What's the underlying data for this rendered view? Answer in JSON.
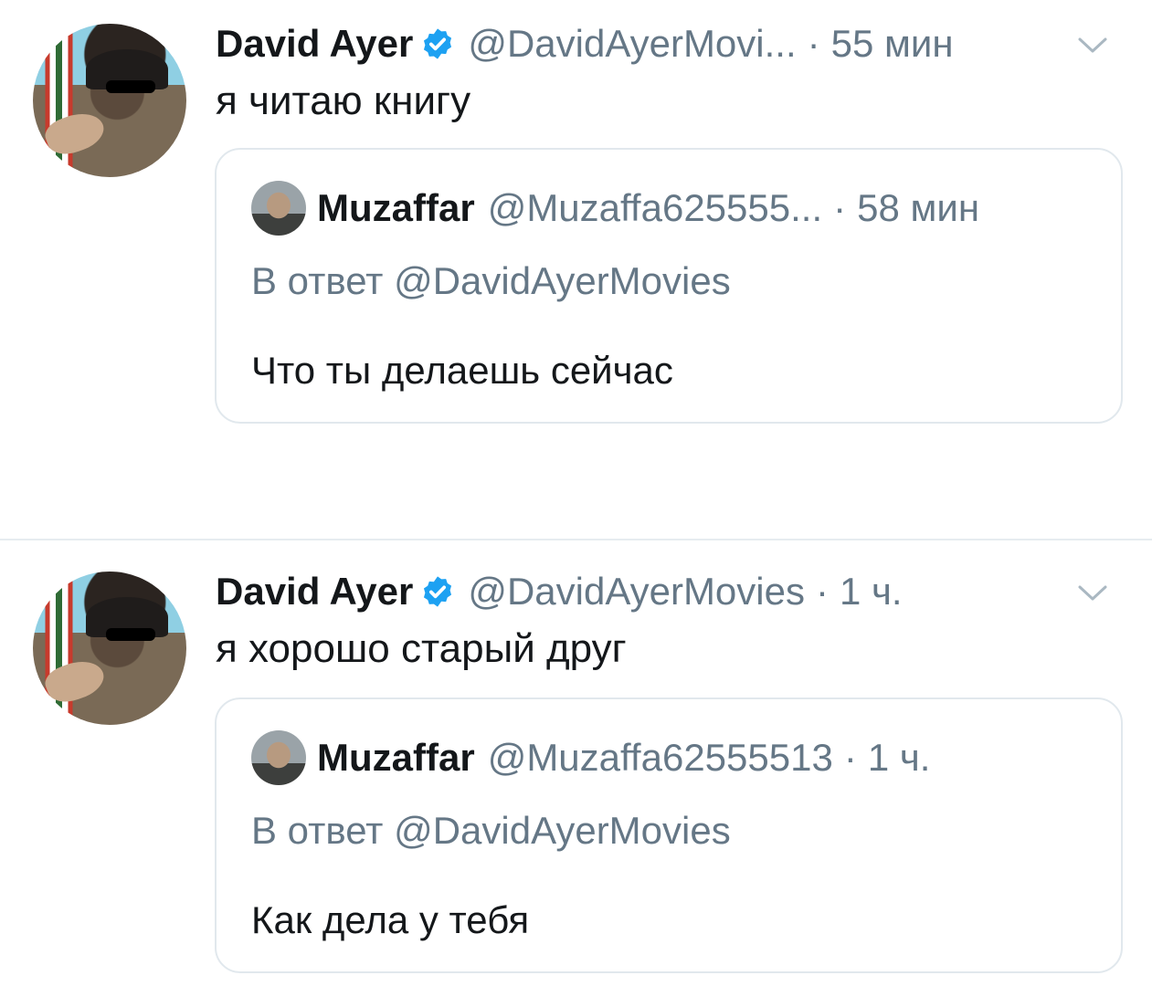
{
  "tweets": [
    {
      "author": {
        "name": "David Ayer",
        "handle": "@DavidAyerMovi...",
        "time": "55 мин",
        "separator": "·"
      },
      "text": "я читаю книгу",
      "quote": {
        "author": {
          "name": "Muzaffar",
          "handle": "@Muzaffa625555...",
          "time": "58 мин",
          "separator": "·"
        },
        "reply_to": "В ответ @DavidAyerMovies",
        "text": "Что ты делаешь сейчас"
      }
    },
    {
      "author": {
        "name": "David Ayer",
        "handle": "@DavidAyerMovies",
        "time": "1 ч.",
        "separator": "·"
      },
      "text": "я хорошо старый друг",
      "quote": {
        "author": {
          "name": "Muzaffar",
          "handle": "@Muzaffa62555513",
          "time": "1 ч.",
          "separator": "·"
        },
        "reply_to": "В ответ @DavidAyerMovies",
        "text": "Как дела у тебя"
      }
    }
  ],
  "colors": {
    "verified": "#1da1f2",
    "secondary_text": "#657786",
    "border": "#e1e8ed"
  },
  "icons": {
    "verified": "verified-badge-icon",
    "menu": "chevron-down-icon"
  }
}
